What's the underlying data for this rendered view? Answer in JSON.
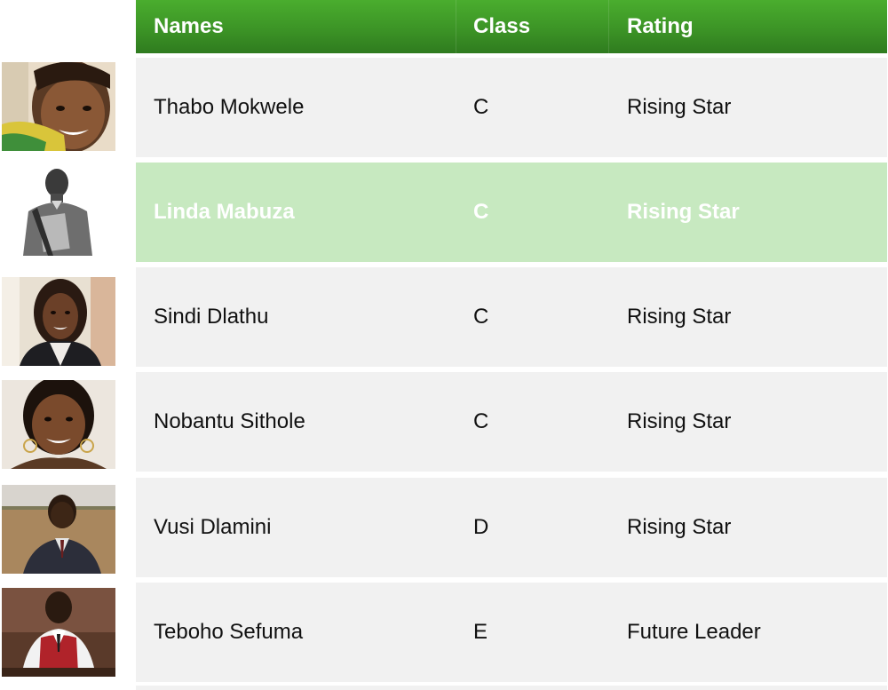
{
  "table": {
    "headers": {
      "names": "Names",
      "class": "Class",
      "rating": "Rating"
    },
    "highlight_color": "#c7e9c0",
    "header_color": "#3c9426",
    "rows": [
      {
        "name": "Thabo Mokwele",
        "class": "C",
        "rating": "Rising Star",
        "photo": "portrait-photo-girl-smiling"
      },
      {
        "name": "Linda Mabuza",
        "class": "C",
        "rating": "Rising Star",
        "photo": "portrait-photo-boy-with-folder"
      },
      {
        "name": "Sindi Dlathu",
        "class": "C",
        "rating": "Rising Star",
        "photo": "portrait-photo-young-woman"
      },
      {
        "name": "Nobantu Sithole",
        "class": "C",
        "rating": "Rising Star",
        "photo": "portrait-photo-girl-with-earrings"
      },
      {
        "name": "Vusi Dlamini",
        "class": "D",
        "rating": "Rising Star",
        "photo": "portrait-photo-boy-in-field"
      },
      {
        "name": "Teboho Sefuma",
        "class": "E",
        "rating": "Future Leader",
        "photo": "portrait-photo-boy-in-red-sweater"
      }
    ]
  }
}
